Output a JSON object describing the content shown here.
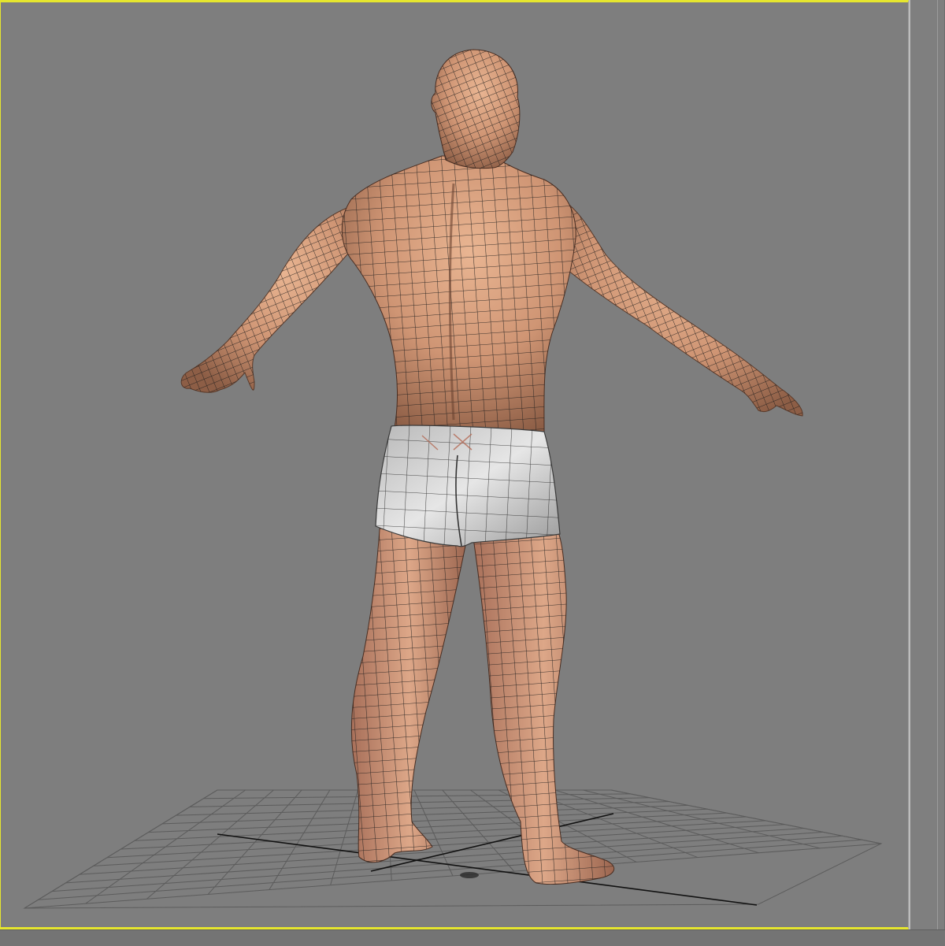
{
  "viewport": {
    "active_border_color": "#e6e62e",
    "background_color": "#7e7e7e"
  },
  "scene": {
    "model": "human-male-figure",
    "pose": "t-pose",
    "view": "back-three-quarter",
    "display_mode": "smooth-shaded-with-wireframe",
    "skin_color": "#d49a78",
    "shorts_color": "#d7d7d7",
    "wire_color": "#1a1a1a",
    "grid_color": "#5a5a5a",
    "grid_axis_color": "#111111"
  }
}
